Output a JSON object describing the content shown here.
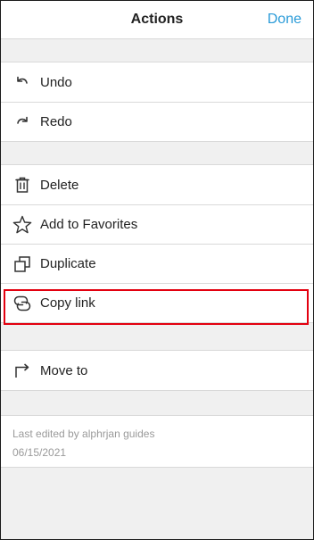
{
  "header": {
    "title": "Actions",
    "done_label": "Done"
  },
  "groups": [
    {
      "items": [
        {
          "label": "Undo",
          "icon": "undo-icon"
        },
        {
          "label": "Redo",
          "icon": "redo-icon"
        }
      ]
    },
    {
      "items": [
        {
          "label": "Delete",
          "icon": "trash-icon"
        },
        {
          "label": "Add to Favorites",
          "icon": "star-icon"
        },
        {
          "label": "Duplicate",
          "icon": "duplicate-icon"
        },
        {
          "label": "Copy link",
          "icon": "link-icon",
          "highlighted": true
        }
      ]
    },
    {
      "items": [
        {
          "label": "Move to",
          "icon": "move-to-icon"
        }
      ]
    }
  ],
  "meta": {
    "edited_by": "Last edited by alphrjan guides",
    "date": "06/15/2021"
  },
  "colors": {
    "accent": "#2a9bd8",
    "highlight": "#e3000f",
    "muted_text": "#9a9a9a"
  }
}
